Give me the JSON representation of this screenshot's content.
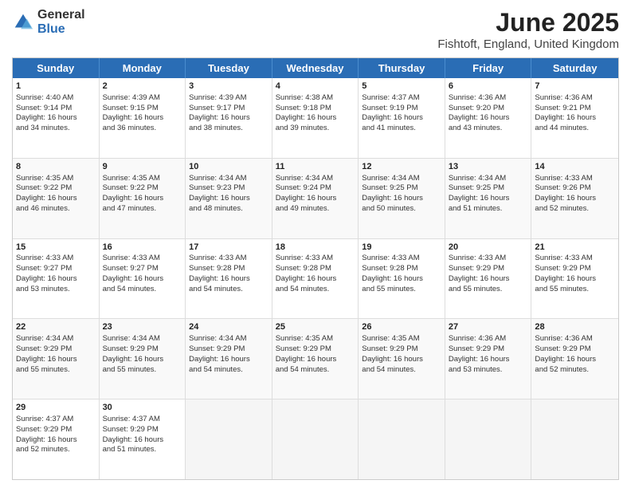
{
  "header": {
    "logo_general": "General",
    "logo_blue": "Blue",
    "title": "June 2025",
    "subtitle": "Fishtoft, England, United Kingdom"
  },
  "days_of_week": [
    "Sunday",
    "Monday",
    "Tuesday",
    "Wednesday",
    "Thursday",
    "Friday",
    "Saturday"
  ],
  "weeks": [
    [
      {
        "day": "1",
        "lines": [
          "Sunrise: 4:40 AM",
          "Sunset: 9:14 PM",
          "Daylight: 16 hours",
          "and 34 minutes."
        ]
      },
      {
        "day": "2",
        "lines": [
          "Sunrise: 4:39 AM",
          "Sunset: 9:15 PM",
          "Daylight: 16 hours",
          "and 36 minutes."
        ]
      },
      {
        "day": "3",
        "lines": [
          "Sunrise: 4:39 AM",
          "Sunset: 9:17 PM",
          "Daylight: 16 hours",
          "and 38 minutes."
        ]
      },
      {
        "day": "4",
        "lines": [
          "Sunrise: 4:38 AM",
          "Sunset: 9:18 PM",
          "Daylight: 16 hours",
          "and 39 minutes."
        ]
      },
      {
        "day": "5",
        "lines": [
          "Sunrise: 4:37 AM",
          "Sunset: 9:19 PM",
          "Daylight: 16 hours",
          "and 41 minutes."
        ]
      },
      {
        "day": "6",
        "lines": [
          "Sunrise: 4:36 AM",
          "Sunset: 9:20 PM",
          "Daylight: 16 hours",
          "and 43 minutes."
        ]
      },
      {
        "day": "7",
        "lines": [
          "Sunrise: 4:36 AM",
          "Sunset: 9:21 PM",
          "Daylight: 16 hours",
          "and 44 minutes."
        ]
      }
    ],
    [
      {
        "day": "8",
        "lines": [
          "Sunrise: 4:35 AM",
          "Sunset: 9:22 PM",
          "Daylight: 16 hours",
          "and 46 minutes."
        ]
      },
      {
        "day": "9",
        "lines": [
          "Sunrise: 4:35 AM",
          "Sunset: 9:22 PM",
          "Daylight: 16 hours",
          "and 47 minutes."
        ]
      },
      {
        "day": "10",
        "lines": [
          "Sunrise: 4:34 AM",
          "Sunset: 9:23 PM",
          "Daylight: 16 hours",
          "and 48 minutes."
        ]
      },
      {
        "day": "11",
        "lines": [
          "Sunrise: 4:34 AM",
          "Sunset: 9:24 PM",
          "Daylight: 16 hours",
          "and 49 minutes."
        ]
      },
      {
        "day": "12",
        "lines": [
          "Sunrise: 4:34 AM",
          "Sunset: 9:25 PM",
          "Daylight: 16 hours",
          "and 50 minutes."
        ]
      },
      {
        "day": "13",
        "lines": [
          "Sunrise: 4:34 AM",
          "Sunset: 9:25 PM",
          "Daylight: 16 hours",
          "and 51 minutes."
        ]
      },
      {
        "day": "14",
        "lines": [
          "Sunrise: 4:33 AM",
          "Sunset: 9:26 PM",
          "Daylight: 16 hours",
          "and 52 minutes."
        ]
      }
    ],
    [
      {
        "day": "15",
        "lines": [
          "Sunrise: 4:33 AM",
          "Sunset: 9:27 PM",
          "Daylight: 16 hours",
          "and 53 minutes."
        ]
      },
      {
        "day": "16",
        "lines": [
          "Sunrise: 4:33 AM",
          "Sunset: 9:27 PM",
          "Daylight: 16 hours",
          "and 54 minutes."
        ]
      },
      {
        "day": "17",
        "lines": [
          "Sunrise: 4:33 AM",
          "Sunset: 9:28 PM",
          "Daylight: 16 hours",
          "and 54 minutes."
        ]
      },
      {
        "day": "18",
        "lines": [
          "Sunrise: 4:33 AM",
          "Sunset: 9:28 PM",
          "Daylight: 16 hours",
          "and 54 minutes."
        ]
      },
      {
        "day": "19",
        "lines": [
          "Sunrise: 4:33 AM",
          "Sunset: 9:28 PM",
          "Daylight: 16 hours",
          "and 55 minutes."
        ]
      },
      {
        "day": "20",
        "lines": [
          "Sunrise: 4:33 AM",
          "Sunset: 9:29 PM",
          "Daylight: 16 hours",
          "and 55 minutes."
        ]
      },
      {
        "day": "21",
        "lines": [
          "Sunrise: 4:33 AM",
          "Sunset: 9:29 PM",
          "Daylight: 16 hours",
          "and 55 minutes."
        ]
      }
    ],
    [
      {
        "day": "22",
        "lines": [
          "Sunrise: 4:34 AM",
          "Sunset: 9:29 PM",
          "Daylight: 16 hours",
          "and 55 minutes."
        ]
      },
      {
        "day": "23",
        "lines": [
          "Sunrise: 4:34 AM",
          "Sunset: 9:29 PM",
          "Daylight: 16 hours",
          "and 55 minutes."
        ]
      },
      {
        "day": "24",
        "lines": [
          "Sunrise: 4:34 AM",
          "Sunset: 9:29 PM",
          "Daylight: 16 hours",
          "and 54 minutes."
        ]
      },
      {
        "day": "25",
        "lines": [
          "Sunrise: 4:35 AM",
          "Sunset: 9:29 PM",
          "Daylight: 16 hours",
          "and 54 minutes."
        ]
      },
      {
        "day": "26",
        "lines": [
          "Sunrise: 4:35 AM",
          "Sunset: 9:29 PM",
          "Daylight: 16 hours",
          "and 54 minutes."
        ]
      },
      {
        "day": "27",
        "lines": [
          "Sunrise: 4:36 AM",
          "Sunset: 9:29 PM",
          "Daylight: 16 hours",
          "and 53 minutes."
        ]
      },
      {
        "day": "28",
        "lines": [
          "Sunrise: 4:36 AM",
          "Sunset: 9:29 PM",
          "Daylight: 16 hours",
          "and 52 minutes."
        ]
      }
    ],
    [
      {
        "day": "29",
        "lines": [
          "Sunrise: 4:37 AM",
          "Sunset: 9:29 PM",
          "Daylight: 16 hours",
          "and 52 minutes."
        ]
      },
      {
        "day": "30",
        "lines": [
          "Sunrise: 4:37 AM",
          "Sunset: 9:29 PM",
          "Daylight: 16 hours",
          "and 51 minutes."
        ]
      },
      {
        "day": "",
        "lines": []
      },
      {
        "day": "",
        "lines": []
      },
      {
        "day": "",
        "lines": []
      },
      {
        "day": "",
        "lines": []
      },
      {
        "day": "",
        "lines": []
      }
    ]
  ]
}
